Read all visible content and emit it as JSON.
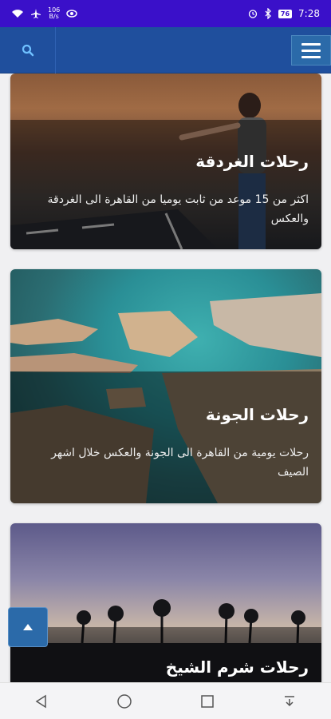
{
  "status": {
    "speed_top": "106",
    "speed_bottom": "B/s",
    "battery": "76",
    "time": "7:28"
  },
  "header": {
    "search_icon": "search-icon",
    "menu_icon": "hamburger-menu-icon"
  },
  "cards": [
    {
      "title": "رحلات الغردقة",
      "description": "اكثر من 15 موعد من ثابت يوميا من القاهرة الى الغردقة والعكس"
    },
    {
      "title": "رحلات الجونة",
      "description": "رحلات يومية من القاهرة الى الجونة والعكس خلال اشهر الصيف"
    },
    {
      "title": "رحلات شرم الشيخ"
    }
  ],
  "colors": {
    "status_bar": "#3a10c9",
    "app_bar": "#1f4f9d",
    "button": "#2b6aa9"
  }
}
